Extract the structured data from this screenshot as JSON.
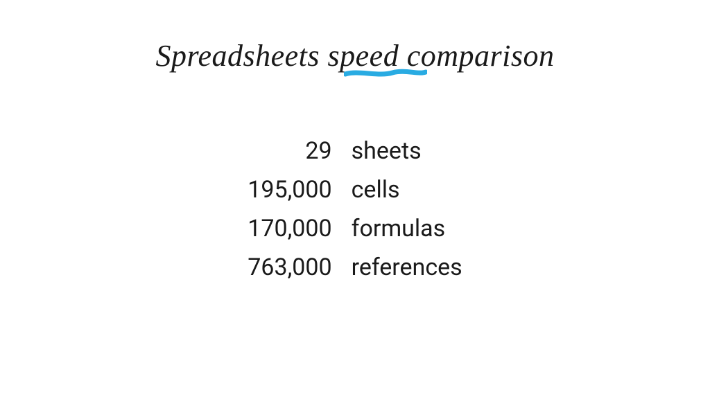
{
  "title": "Spreadsheets speed comparison",
  "accent_color": "#29abe2",
  "stats": [
    {
      "value": "29",
      "label": "sheets"
    },
    {
      "value": "195,000",
      "label": "cells"
    },
    {
      "value": "170,000",
      "label": "formulas"
    },
    {
      "value": "763,000",
      "label": "references"
    }
  ]
}
